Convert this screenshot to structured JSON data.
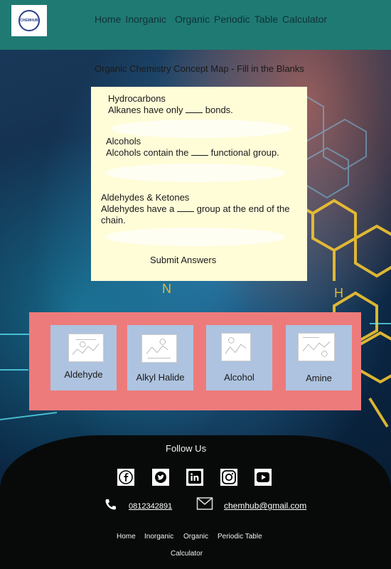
{
  "brand": {
    "logo_text": "CHEMHUB"
  },
  "nav": {
    "home": "Home",
    "inorganic": "Inorganic",
    "organic": "Organic",
    "periodic": "Periodic",
    "table": "Table",
    "calculator": "Calculator"
  },
  "quiz": {
    "title": "Organic Chemistry Concept Map - Fill in the Blanks",
    "questions": [
      {
        "topic": "Hydrocarbons",
        "before": "Alkanes have only",
        "after": "bonds."
      },
      {
        "topic": "Alcohols",
        "before": "Alcohols contain the",
        "after": "functional group."
      },
      {
        "topic": "Aldehydes & Ketones",
        "before": "Aldehydes have a",
        "after": "group at the end of the",
        "after2": "chain."
      }
    ],
    "submit_label": "Submit Answers"
  },
  "topics": [
    {
      "label": "Aldehyde"
    },
    {
      "label": "Alkyl Halide"
    },
    {
      "label": "Alcohol"
    },
    {
      "label": "Amine"
    }
  ],
  "footer": {
    "follow": "Follow Us",
    "social": [
      "facebook-icon",
      "twitter-icon",
      "linkedin-icon",
      "instagram-icon",
      "youtube-icon"
    ],
    "phone": "0812342891",
    "email": "chemhub@gmail.com",
    "nav": {
      "home": "Home",
      "inorganic": "Inorganic",
      "organic": "Organic",
      "periodic_table": "Periodic Table",
      "calculator": "Calculator"
    }
  },
  "colors": {
    "header": "#1f7a73",
    "quiz_card": "#fffcd8",
    "topics_panel": "#ee7b7b",
    "topic_card": "#aec3df",
    "footer": "#080a0a"
  }
}
